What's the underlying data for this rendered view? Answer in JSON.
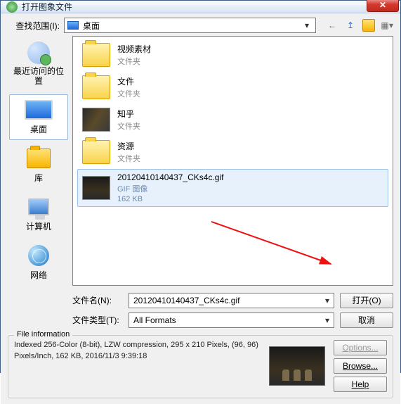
{
  "titlebar": {
    "title": "打开图象文件"
  },
  "toolbar": {
    "look_in_label": "查找范围(I):",
    "location": "桌面",
    "nav": {
      "back": "←",
      "up": "↥",
      "newfolder": "✳",
      "views": "▦"
    }
  },
  "sidebar": {
    "items": [
      {
        "label": "最近访问的位置"
      },
      {
        "label": "桌面"
      },
      {
        "label": "库"
      },
      {
        "label": "计算机"
      },
      {
        "label": "网络"
      }
    ]
  },
  "files": {
    "items": [
      {
        "name": "视频素材",
        "meta": "文件夹"
      },
      {
        "name": "文件",
        "meta": "文件夹"
      },
      {
        "name": "知乎",
        "meta": "文件夹"
      },
      {
        "name": "资源",
        "meta": "文件夹"
      },
      {
        "name": "20120410140437_CKs4c.gif",
        "meta": "GIF 图像",
        "size": "162 KB"
      }
    ]
  },
  "fields": {
    "filename_label": "文件名(N):",
    "filename_value": "20120410140437_CKs4c.gif",
    "filetype_label": "文件类型(T):",
    "filetype_value": "All Formats"
  },
  "buttons": {
    "open": "打开(O)",
    "cancel": "取消",
    "options": "Options...",
    "browse": "Browse...",
    "help": "Help"
  },
  "fileinfo": {
    "legend": "File information",
    "text": "Indexed 256-Color (8-bit), LZW compression, 295 x 210 Pixels, (96, 96) Pixels/Inch, 162 KB, 2016/11/3 9:39:18"
  }
}
